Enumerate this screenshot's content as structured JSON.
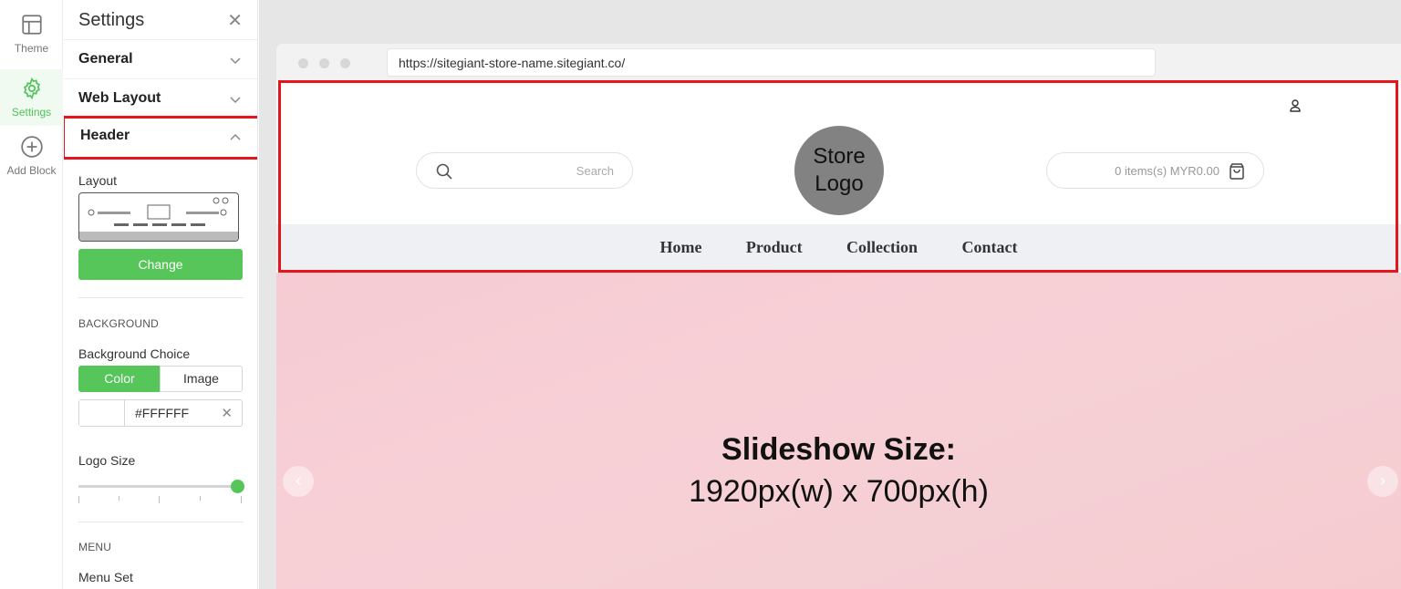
{
  "rail": {
    "items": [
      {
        "label": "Theme",
        "icon": "layout-icon"
      },
      {
        "label": "Settings",
        "icon": "gear-icon",
        "active": true
      },
      {
        "label": "Add Block",
        "icon": "plus-circle-icon"
      }
    ]
  },
  "panel": {
    "title": "Settings",
    "close_icon": "close-icon",
    "sections": [
      {
        "label": "General",
        "expanded": false
      },
      {
        "label": "Web Layout",
        "expanded": false
      },
      {
        "label": "Header",
        "expanded": true
      }
    ],
    "layout_label": "Layout",
    "change_button": "Change",
    "background_heading": "BACKGROUND",
    "background_choice_label": "Background Choice",
    "background_options": [
      "Color",
      "Image"
    ],
    "background_selected": "Color",
    "color_value": "#FFFFFF",
    "logo_size_label": "Logo Size",
    "logo_size_value": 1.0,
    "menu_heading": "MENU",
    "menu_set_label": "Menu Set"
  },
  "browser": {
    "url": "https://sitegiant-store-name.sitegiant.co/"
  },
  "store_header": {
    "search_placeholder": "Search",
    "logo_line1": "Store",
    "logo_line2": "Logo",
    "cart_text": "0 items(s) MYR0.00",
    "nav_items": [
      "Home",
      "Product",
      "Collection",
      "Contact"
    ]
  },
  "slideshow": {
    "title": "Slideshow Size:",
    "subtitle": "1920px(w) x 700px(h)"
  },
  "colors": {
    "accent": "#56c65a",
    "highlight": "#e8141c",
    "slide_bg": "#f6cbd3"
  }
}
